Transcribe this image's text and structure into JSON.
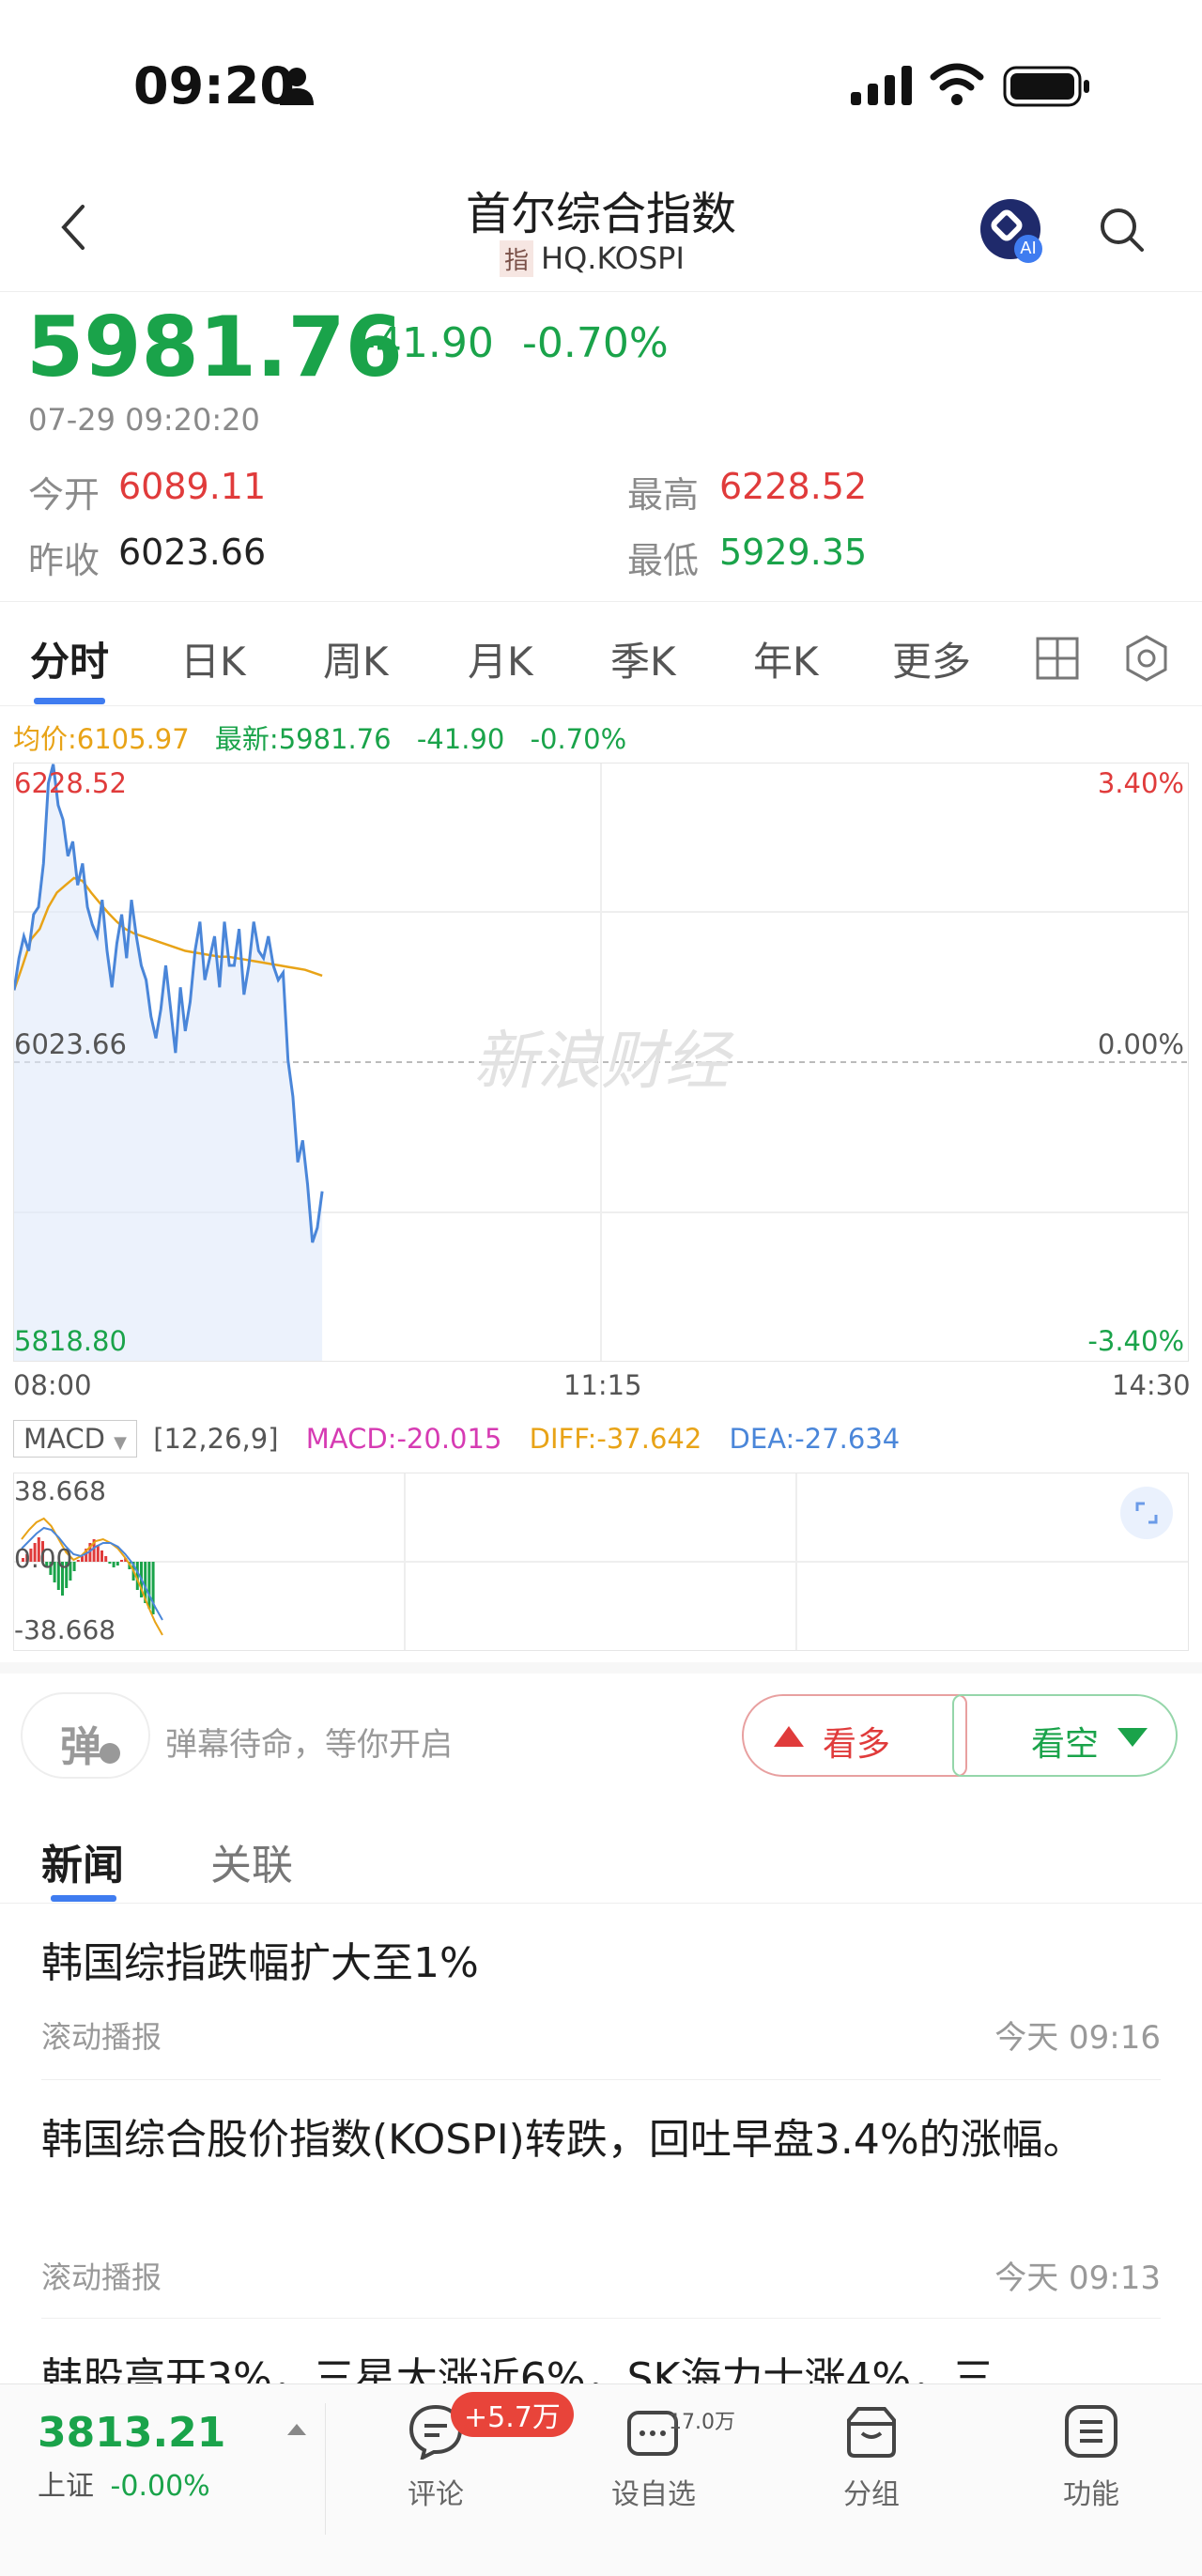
{
  "status_bar": {
    "time": "09:20"
  },
  "header": {
    "title": "首尔综合指数",
    "code_tag": "指",
    "code": "HQ.KOSPI",
    "ai_badge": "AI"
  },
  "quote": {
    "price": "5981.76",
    "change": "-41.90",
    "change_pct": "-0.70%",
    "datetime": "07-29 09:20:20",
    "open_label": "今开",
    "open": "6089.11",
    "high_label": "最高",
    "high": "6228.52",
    "prev_close_label": "昨收",
    "prev_close": "6023.66",
    "low_label": "最低",
    "low": "5929.35"
  },
  "tabs": [
    "分时",
    "日K",
    "周K",
    "月K",
    "季K",
    "年K",
    "更多"
  ],
  "chart_info": {
    "avg": "均价:6105.97",
    "latest": "最新:5981.76",
    "change": "-41.90",
    "change_pct": "-0.70%"
  },
  "chart_data": {
    "type": "line",
    "y_labels": {
      "top": "6228.52",
      "mid": "6023.66",
      "bottom": "5818.80"
    },
    "pct_labels": {
      "top": "3.40%",
      "mid": "0.00%",
      "bottom": "-3.40%"
    },
    "x_labels": [
      "08:00",
      "11:15",
      "14:30"
    ],
    "ylim": [
      5818.8,
      6228.52
    ],
    "watermark": "新浪财经",
    "series": [
      {
        "values": [
          6073,
          6095,
          6110,
          6100,
          6125,
          6130,
          6160,
          6215,
          6228,
          6200,
          6190,
          6165,
          6175,
          6145,
          6160,
          6130,
          6118,
          6110,
          6135,
          6100,
          6075,
          6105,
          6125,
          6095,
          6135,
          6110,
          6090,
          6080,
          6055,
          6040,
          6060,
          6090,
          6060,
          6030,
          6075,
          6045,
          6065,
          6100,
          6120,
          6080,
          6095,
          6110,
          6075,
          6120,
          6090,
          6090,
          6115,
          6070,
          6090,
          6120,
          6100,
          6095,
          6110,
          6090,
          6080,
          6085,
          6025,
          6000,
          5955,
          5970,
          5940,
          5900,
          5910,
          5935
        ]
      },
      {
        "values": [
          6073,
          6090,
          6108,
          6115,
          6130,
          6140,
          6145,
          6150,
          6148,
          6140,
          6133,
          6126,
          6120,
          6115,
          6112,
          6110,
          6108,
          6106,
          6104,
          6102,
          6100,
          6099,
          6098,
          6097,
          6096,
          6096,
          6095,
          6094,
          6093,
          6092,
          6091,
          6090,
          6089,
          6088,
          6087,
          6085,
          6083
        ]
      }
    ]
  },
  "macd": {
    "dropdown": "MACD",
    "params": "[12,26,9]",
    "macd": "MACD:-20.015",
    "diff": "DIFF:-37.642",
    "dea": "DEA:-27.634",
    "top": "38.668",
    "mid": "0.00",
    "bottom": "-38.668"
  },
  "danmu": {
    "icon_char": "弹",
    "placeholder": "弹幕待命，等你开启"
  },
  "vote": {
    "bull": "看多",
    "bear": "看空"
  },
  "news_tabs": [
    "新闻",
    "关联"
  ],
  "news": [
    {
      "title": "韩国综指跌幅扩大至1%",
      "source": "滚动播报",
      "time": "今天 09:16"
    },
    {
      "title": "韩国综合股价指数(KOSPI)转跌，回吐早盘3.4%的涨幅。",
      "source": "滚动播报",
      "time": "今天 09:13"
    },
    {
      "title": "韩股高开3%，三星大涨近6%，SK海力士涨4%，三"
    }
  ],
  "bottom_bar": {
    "index_value": "3813.21",
    "index_name": "上证",
    "index_change": "-0.00%",
    "comment_label": "评论",
    "comment_badge": "+5.7万",
    "watch_label": "设自选",
    "watch_count": "17.0万",
    "group_label": "分组",
    "func_label": "功能"
  }
}
